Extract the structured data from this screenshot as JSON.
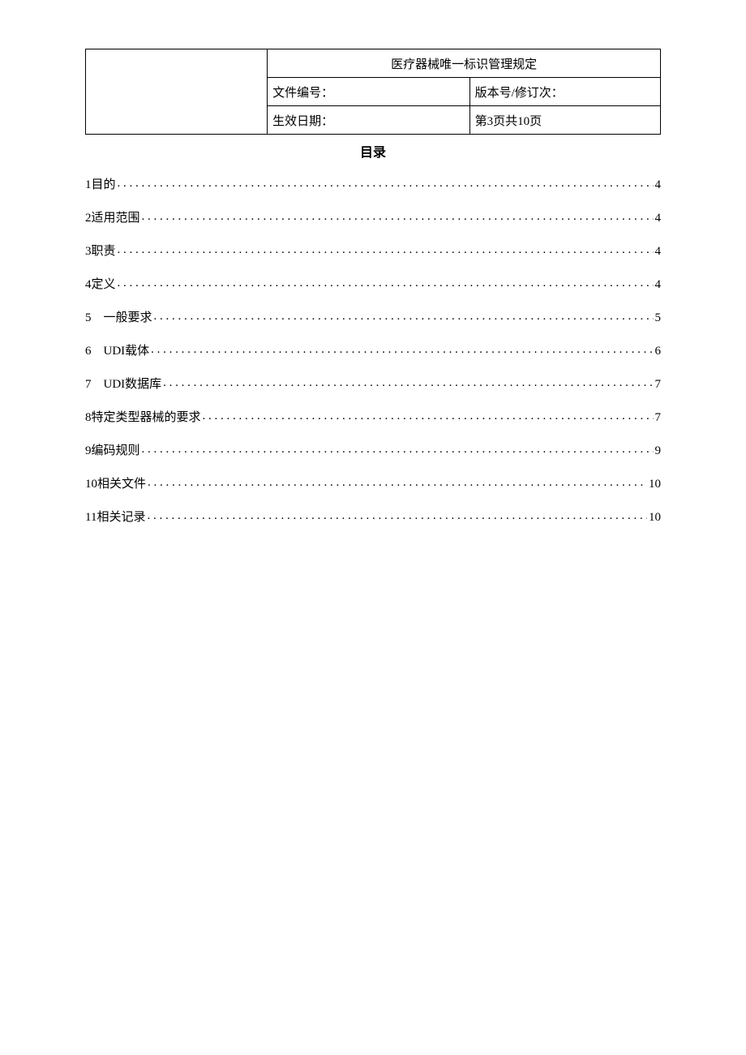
{
  "header": {
    "title": "医疗器械唯一标识管理规定",
    "docNoLabel": "文件编号：",
    "docNoValue": "",
    "versionLabel": "版本号/修订次：",
    "versionValue": "",
    "effDateLabel": "生效日期：",
    "effDateValue": "",
    "pageInfo": "第3页共10页"
  },
  "toc": {
    "heading": "目录",
    "items": [
      {
        "label": "1目的",
        "page": "4"
      },
      {
        "label": "2适用范围",
        "page": "4"
      },
      {
        "label": "3职责",
        "page": "4"
      },
      {
        "label": "4定义",
        "page": "4"
      },
      {
        "label": "5　一般要求",
        "page": "5"
      },
      {
        "label": "6　UDI载体",
        "page": "6"
      },
      {
        "label": "7　UDI数据库",
        "page": "7"
      },
      {
        "label": "8特定类型器械的要求",
        "page": "7"
      },
      {
        "label": "9编码规则",
        "page": "9"
      },
      {
        "label": "10相关文件",
        "page": "10"
      },
      {
        "label": "11相关记录",
        "page": "10"
      }
    ]
  }
}
